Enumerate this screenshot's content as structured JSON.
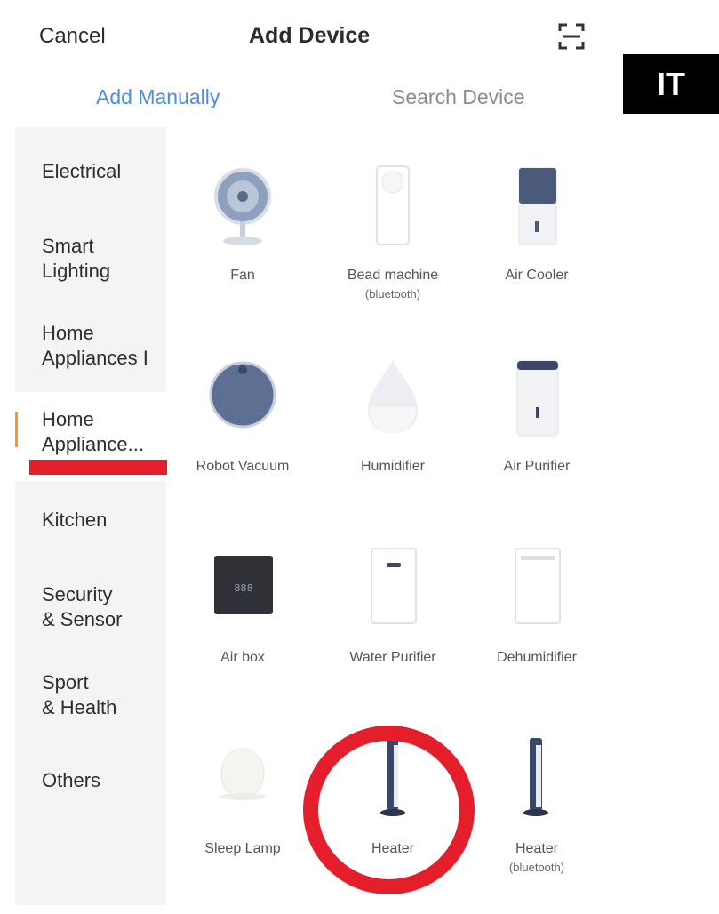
{
  "header": {
    "cancel_label": "Cancel",
    "title": "Add Device",
    "scan_icon": "scan-icon"
  },
  "badge": {
    "text": "IT"
  },
  "tabs": {
    "manual": "Add Manually",
    "search": "Search Device"
  },
  "categories": [
    {
      "line1": "Electrical",
      "line2": ""
    },
    {
      "line1": "Smart",
      "line2": "Lighting"
    },
    {
      "line1": "Home",
      "line2": "Appliances I"
    },
    {
      "line1": "Home",
      "line2": "Appliance..."
    },
    {
      "line1": "Kitchen",
      "line2": ""
    },
    {
      "line1": "Security",
      "line2": "& Sensor"
    },
    {
      "line1": "Sport",
      "line2": "& Health"
    },
    {
      "line1": "Others",
      "line2": ""
    }
  ],
  "selected_category_index": 3,
  "devices": [
    {
      "name": "Fan",
      "sub": ""
    },
    {
      "name": "Bead machine",
      "sub": "(bluetooth)"
    },
    {
      "name": "Air Cooler",
      "sub": ""
    },
    {
      "name": "Robot Vacuum",
      "sub": ""
    },
    {
      "name": "Humidifier",
      "sub": ""
    },
    {
      "name": "Air Purifier",
      "sub": ""
    },
    {
      "name": "Air box",
      "sub": ""
    },
    {
      "name": "Water Purifier",
      "sub": ""
    },
    {
      "name": "Dehumidifier",
      "sub": ""
    },
    {
      "name": "Sleep Lamp",
      "sub": ""
    },
    {
      "name": "Heater",
      "sub": ""
    },
    {
      "name": "Heater",
      "sub": "(bluetooth)"
    }
  ],
  "colors": {
    "accent_tab": "#4d8ce0",
    "active_indicator": "#f39b2a",
    "annotation_red": "#e41f2b",
    "device_navy": "#3a4768"
  }
}
